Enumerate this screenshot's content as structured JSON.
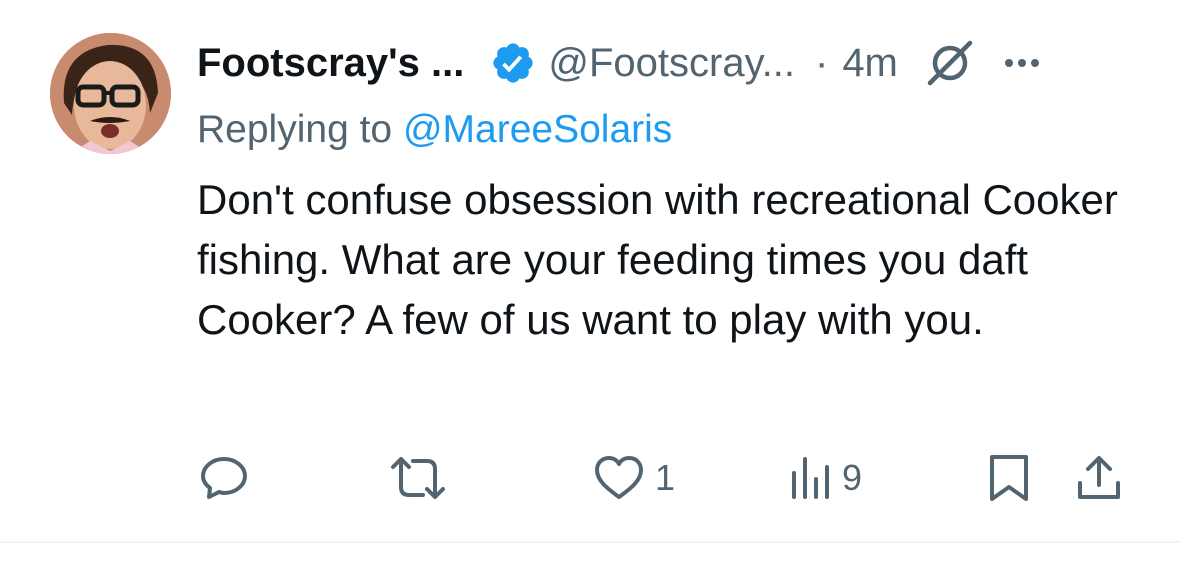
{
  "author": {
    "display_name": "Footscray's ...",
    "handle": "@Footscray...",
    "separator": "·",
    "time": "4m",
    "verified": true
  },
  "reply": {
    "prefix": "Replying to ",
    "mention": "@MareeSolaris"
  },
  "body": {
    "text": "Don't confuse obsession with recreational Cooker fishing. What are your feeding times you daft Cooker? A few of us want to play with you."
  },
  "actions": {
    "reply_icon": "speech-bubble-icon",
    "retweet_icon": "retweet-icon",
    "like_icon": "heart-icon",
    "like_count": "1",
    "views_icon": "bar-chart-icon",
    "views_count": "9",
    "bookmark_icon": "bookmark-icon",
    "share_icon": "share-icon"
  },
  "colors": {
    "primary_text": "#0f1419",
    "secondary_text": "#536471",
    "link": "#1d9bf0",
    "verified_badge": "#1d9bf0"
  }
}
